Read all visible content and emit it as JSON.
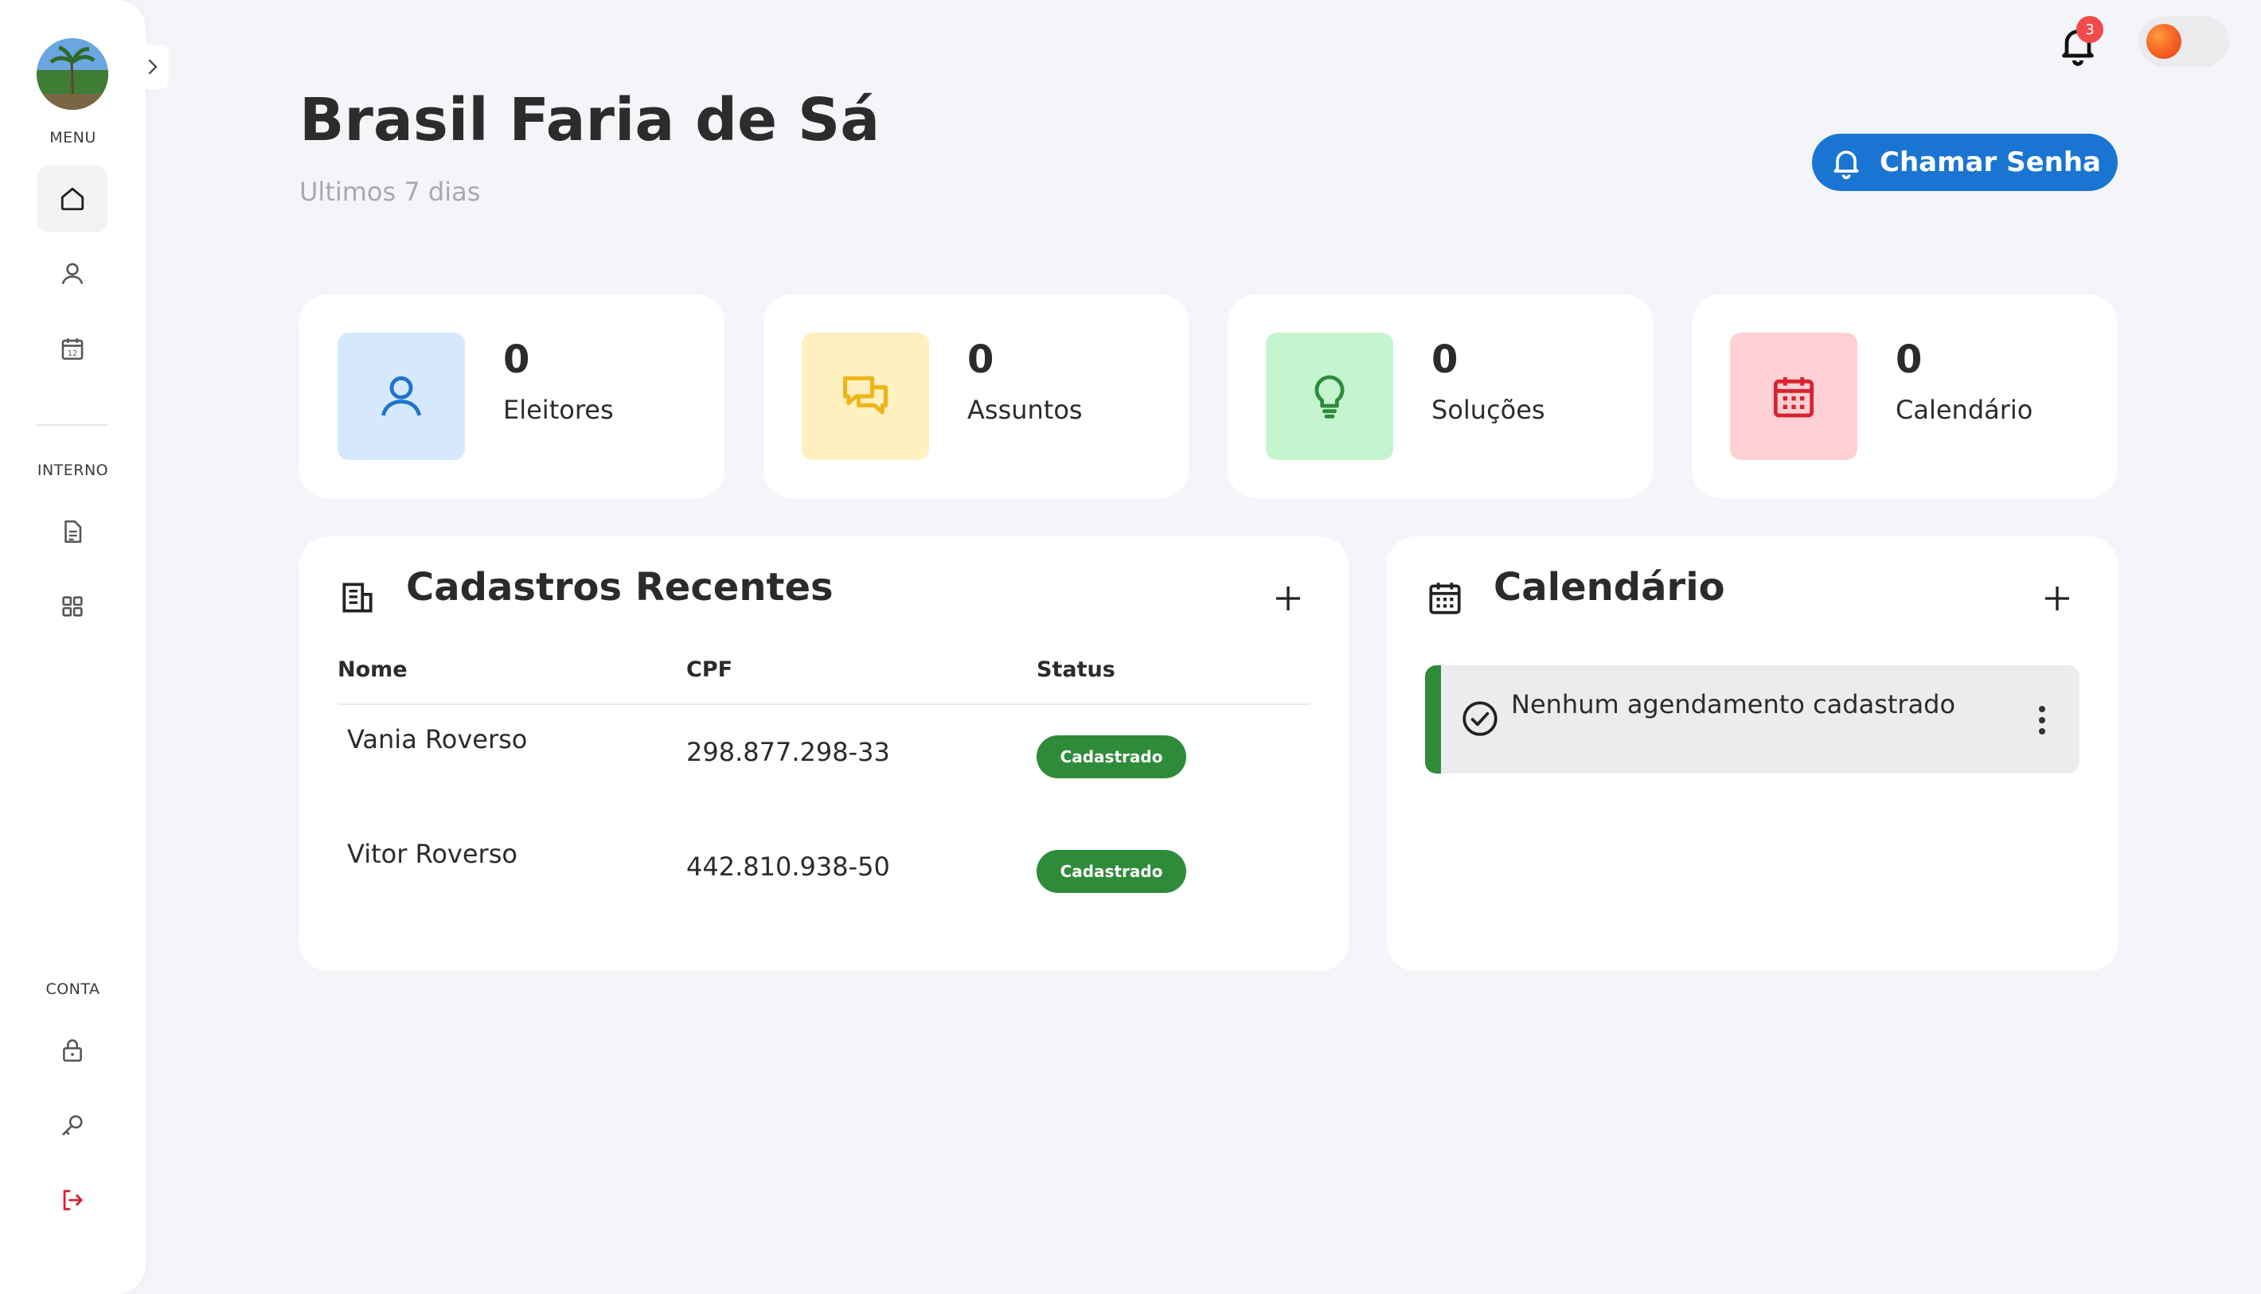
{
  "sidebar": {
    "menu_label": "MENU",
    "interno_label": "INTERNO",
    "conta_label": "CONTA",
    "items": [
      {
        "name": "home",
        "icon": "home-icon"
      },
      {
        "name": "user",
        "icon": "user-icon"
      },
      {
        "name": "calendar",
        "icon": "calendar-icon"
      },
      {
        "name": "document",
        "icon": "document-icon"
      },
      {
        "name": "grid",
        "icon": "grid-icon"
      },
      {
        "name": "lock",
        "icon": "lock-icon"
      },
      {
        "name": "key",
        "icon": "key-icon"
      },
      {
        "name": "logout",
        "icon": "logout-icon"
      }
    ]
  },
  "topbar": {
    "notification_count": "3"
  },
  "header": {
    "title": "Brasil Faria de Sá",
    "subtitle": "Ultimos 7 dias",
    "call_button_label": "Chamar Senha"
  },
  "stats": [
    {
      "value": "0",
      "label": "Eleitores",
      "icon": "user-icon",
      "bg": "#d5e8fd",
      "fg": "#1f73d0"
    },
    {
      "value": "0",
      "label": "Assuntos",
      "icon": "chat-icon",
      "bg": "#fff0bf",
      "fg": "#f1b418"
    },
    {
      "value": "0",
      "label": "Soluções",
      "icon": "lightbulb-icon",
      "bg": "#c4f5cf",
      "fg": "#2e8b3a"
    },
    {
      "value": "0",
      "label": "Calendário",
      "icon": "calendar-icon",
      "bg": "#ffd0d5",
      "fg": "#d9232d"
    }
  ],
  "recent": {
    "title": "Cadastros Recentes",
    "columns": [
      "Nome",
      "CPF",
      "Status"
    ],
    "rows": [
      {
        "name": "Vania Roverso",
        "cpf": "298.877.298-33",
        "status": "Cadastrado"
      },
      {
        "name": "Vitor Roverso",
        "cpf": "442.810.938-50",
        "status": "Cadastrado"
      }
    ]
  },
  "calendar_panel": {
    "title": "Calendário",
    "empty_message": "Nenhum agendamento cadastrado"
  },
  "colors": {
    "accent": "#1a75d2",
    "success": "#2e8b3a",
    "danger": "#d9232d"
  }
}
